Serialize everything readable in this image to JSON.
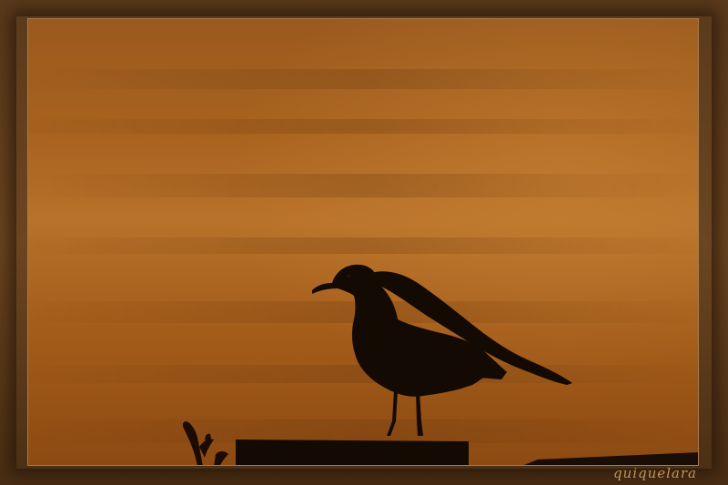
{
  "image": {
    "subject": "seagull-silhouette-at-sunset",
    "sky_colors": [
      "#8a4a14",
      "#b06a22",
      "#c27a2c",
      "#a85e1c"
    ],
    "frame_color": "#5a3a1c",
    "silhouette_color": "#140a04"
  },
  "signature": {
    "text": "quiquelara"
  }
}
